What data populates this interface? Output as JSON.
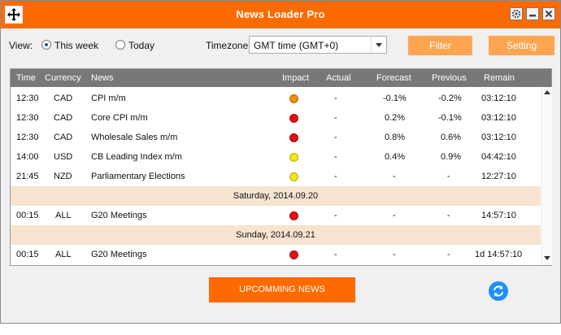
{
  "window": {
    "title": "News Loader Pro"
  },
  "view": {
    "label": "View:",
    "options": [
      "This week",
      "Today"
    ],
    "selected": "This week"
  },
  "timezone": {
    "label": "Timezone:",
    "value": "GMT time (GMT+0)"
  },
  "buttons": {
    "filter": "Filter",
    "setting": "Setting",
    "upcoming": "UPCOMMING NEWS"
  },
  "table": {
    "headers": [
      "Time",
      "Currency",
      "News",
      "Impact",
      "Actual",
      "Forecast",
      "Previous",
      "Remain"
    ],
    "rows": [
      {
        "type": "event",
        "time": "12:30",
        "currency": "CAD",
        "news": "CPI m/m",
        "impact": "orange",
        "actual": "-",
        "forecast": "-0.1%",
        "previous": "-0.2%",
        "remain": "03:12:10"
      },
      {
        "type": "event",
        "time": "12:30",
        "currency": "CAD",
        "news": "Core CPI m/m",
        "impact": "red",
        "actual": "-",
        "forecast": "0.2%",
        "previous": "-0.1%",
        "remain": "03:12:10"
      },
      {
        "type": "event",
        "time": "12:30",
        "currency": "CAD",
        "news": "Wholesale Sales m/m",
        "impact": "red",
        "actual": "-",
        "forecast": "0.8%",
        "previous": "0.6%",
        "remain": "03:12:10"
      },
      {
        "type": "event",
        "time": "14:00",
        "currency": "USD",
        "news": "CB Leading Index m/m",
        "impact": "yellow",
        "actual": "-",
        "forecast": "0.4%",
        "previous": "0.9%",
        "remain": "04:42:10"
      },
      {
        "type": "event",
        "time": "21:45",
        "currency": "NZD",
        "news": "Parliamentary Elections",
        "impact": "yellow",
        "actual": "-",
        "forecast": "-",
        "previous": "-",
        "remain": "12:27:10"
      },
      {
        "type": "date",
        "date": "Saturday, 2014.09.20"
      },
      {
        "type": "event",
        "time": "00:15",
        "currency": "ALL",
        "news": "G20 Meetings",
        "impact": "red",
        "actual": "-",
        "forecast": "-",
        "previous": "-",
        "remain": "14:57:10"
      },
      {
        "type": "date",
        "date": "Sunday, 2014.09.21"
      },
      {
        "type": "event",
        "time": "00:15",
        "currency": "ALL",
        "news": "G20 Meetings",
        "impact": "red",
        "actual": "-",
        "forecast": "-",
        "previous": "-",
        "remain": "1d 14:57:10"
      }
    ]
  },
  "colors": {
    "accent": "#ff6a00",
    "accent_light": "#ffa552",
    "header_bg": "#777878",
    "date_row_bg": "#f6e4d0",
    "impact_red": "#e01010",
    "impact_orange": "#f0900a",
    "impact_yellow": "#f3e60f",
    "refresh": "#1e90ff"
  },
  "icons": {
    "move": "move-arrows-icon",
    "settings": "gear-icon",
    "minimize": "minimize-icon",
    "close": "close-icon",
    "refresh": "refresh-icon"
  }
}
